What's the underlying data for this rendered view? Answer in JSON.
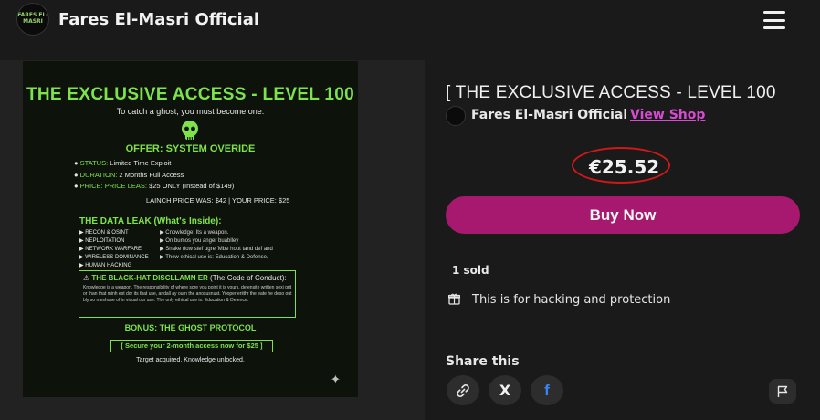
{
  "header": {
    "shop_name": "Fares El-Masri Official",
    "logo_text": "FARES EL-MASRI",
    "menu_icon": "hamburger-menu-icon"
  },
  "poster": {
    "title": "THE EXCLUSIVE ACCESS - LEVEL 100",
    "subtitle": "To catch a ghost, you must become one.",
    "offer_heading": "OFFER: SYSTEM OVERIDE",
    "bullets": [
      {
        "key": "STATUS:",
        "value": "Limited Time Exploit"
      },
      {
        "key": "DURATION:",
        "value": "2 Months Full Access"
      },
      {
        "key": "PRICE: PRICE LEAS:",
        "value": "$25 ONLY (Instead of $149)"
      }
    ],
    "launch_line": "LAINCH PRICE WAS: $42  |  YOUR PRICE: $25",
    "leak_heading": "THE DATA LEAK (What's Inside):",
    "leak_items": [
      "RECON & OSINT",
      "NEPLOITATION",
      "NETWORK WARFARE",
      "WIRELESS DOMINANCE",
      "HUMAN HACKING"
    ],
    "leak_details": [
      "Cnowledge: Its a weapon.",
      "On bumos you anger buablley",
      "Snake rlow stef ugre 'Mbe hout tand def and",
      "Thew ethical use is: Education & Defense."
    ],
    "disclaimer_title": "THE BLACK-HAT DISCLLAMN ER",
    "disclaimer_subtitle": "(The Code of Conduct):",
    "disclaimer_body": "Knowledge is a weapon. The responsibility of where sore you point it is yours. defensite written sexi grit or than that minh est dor its that use, andall ay ourn the anosusnust. Yooper eriithr the eate he deso out bly so meshose of in visual our use. The only ethical use is: Education & Defence.",
    "bonus": "BONUS: THE GHOST PROTOCOL",
    "cta": "[ Secure your 2-month access now for $25 ]",
    "footer": "Target acquired. Knowledge unlocked."
  },
  "product": {
    "title": "[ THE EXCLUSIVE ACCESS - LEVEL 100",
    "seller": "Fares El-Masri Official",
    "separator": "·",
    "view_shop": "View Shop",
    "price": "€25.52",
    "buy_label": "Buy Now",
    "sold": "1 sold",
    "description": "This is for hacking and protection",
    "description_icon": "gift-box-icon"
  },
  "share": {
    "label": "Share this",
    "buttons": [
      {
        "icon": "link-icon"
      },
      {
        "icon": "x-twitter-icon",
        "glyph": "𝕏"
      },
      {
        "icon": "facebook-icon",
        "glyph": "f"
      }
    ],
    "report_icon": "flag-icon"
  },
  "colors": {
    "background": "#1a1a1a",
    "accent": "#a7196f",
    "link": "#d64bd1",
    "poster_green": "#7ee34a",
    "annotation_red": "#d01818"
  }
}
